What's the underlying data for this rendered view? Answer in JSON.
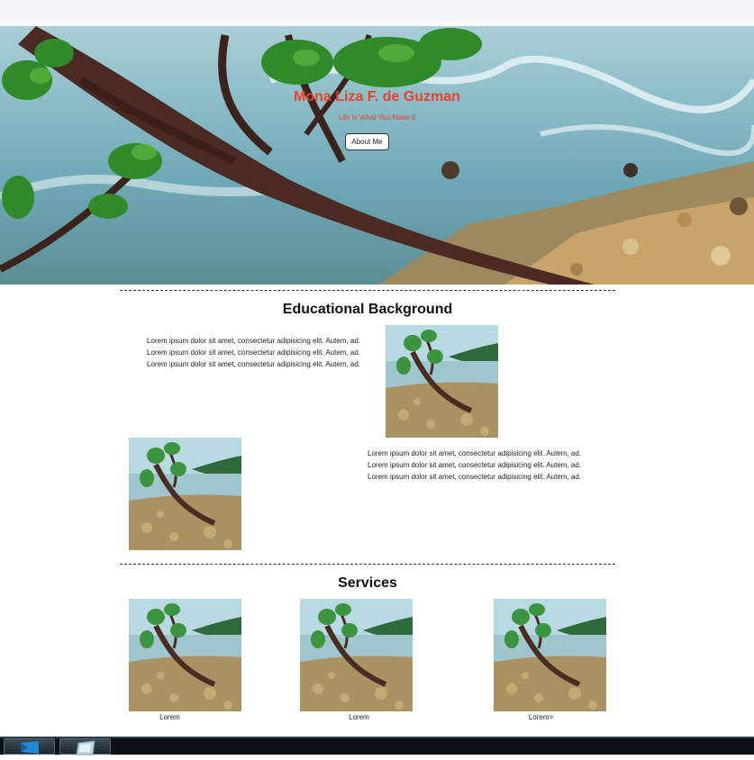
{
  "hero": {
    "title": "Mona Liza F. de Guzman",
    "subtitle": "Life is What You Make it",
    "about_button": "About Me"
  },
  "education": {
    "heading": "Educational Background",
    "block1_lines": [
      "Lorem ipsum dolor sit amet, consectetur adipisicing elit. Autem, ad.",
      "Lorem ipsum dolor sit amet, consectetur adipisicing elit. Autem, ad.",
      "Lorem ipsum dolor sit amet, consectetur adipisicing elit. Autem, ad."
    ],
    "block2_lines": [
      "Lorem ipsum dolor sit amet, consectetur adipisicing elit. Autem, ad.",
      "Lorem ipsum dolor sit amet, consectetur adipisicing elit. Autem, ad.",
      "Lorem ipsum dolor sit amet, consectetur adipisicing elit. Autem, ad."
    ]
  },
  "services": {
    "heading": "Services",
    "items": [
      {
        "caption": "Lorem"
      },
      {
        "caption": "Lorem"
      },
      {
        "caption": "Lorem>"
      }
    ]
  },
  "taskbar": {
    "icons": [
      "vscode-icon",
      "window-icon"
    ]
  },
  "colors": {
    "accent": "#e8412c",
    "sea": "#7fb7c6",
    "foliage": "#2f8a2a"
  }
}
